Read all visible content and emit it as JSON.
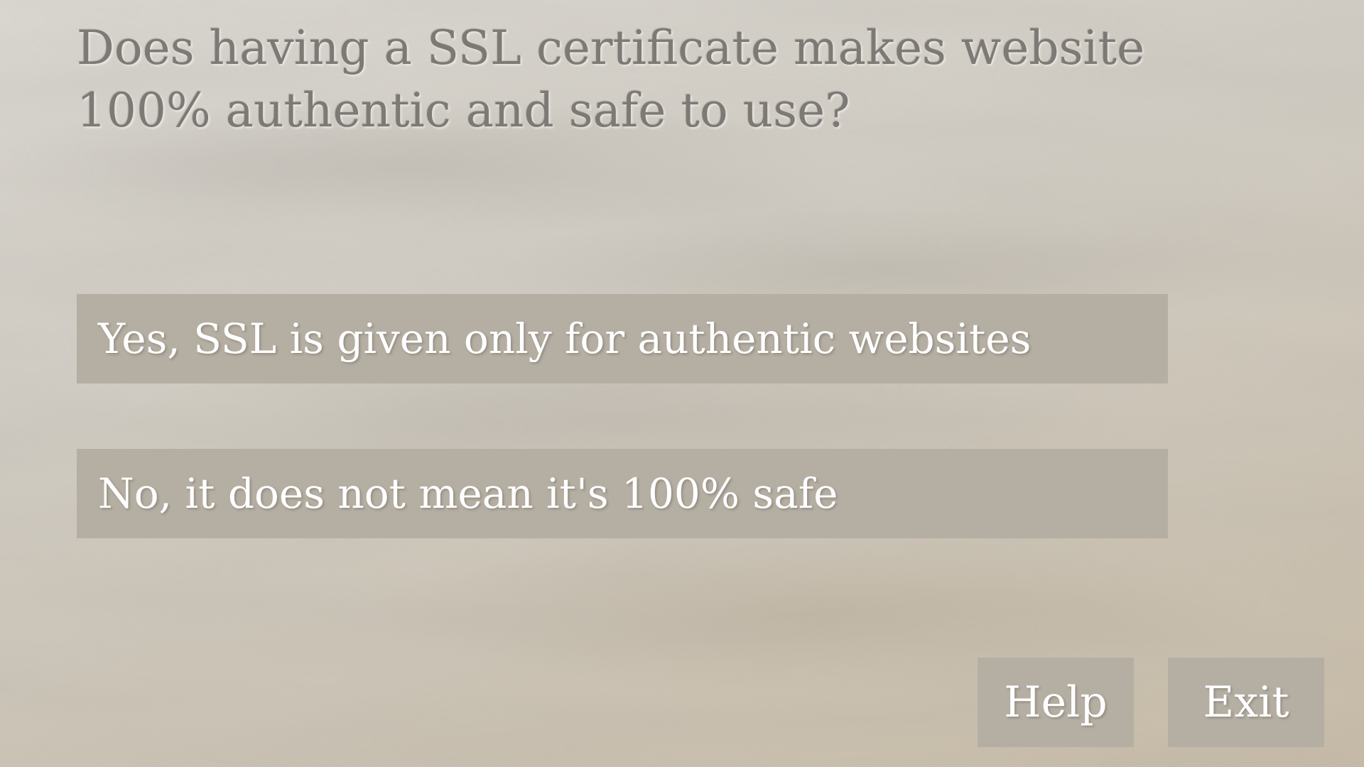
{
  "question": {
    "text": "Does having a SSL certificate makes website 100% authentic and safe to use?"
  },
  "answers": [
    {
      "label": "Yes, SSL is given only for authentic websites"
    },
    {
      "label": "No, it does not mean it's 100% safe"
    }
  ],
  "controls": {
    "help_label": "Help",
    "exit_label": "Exit"
  },
  "colors": {
    "panel": "#b5afa3",
    "question_text": "#7d7a76",
    "button_text": "#ffffff"
  }
}
